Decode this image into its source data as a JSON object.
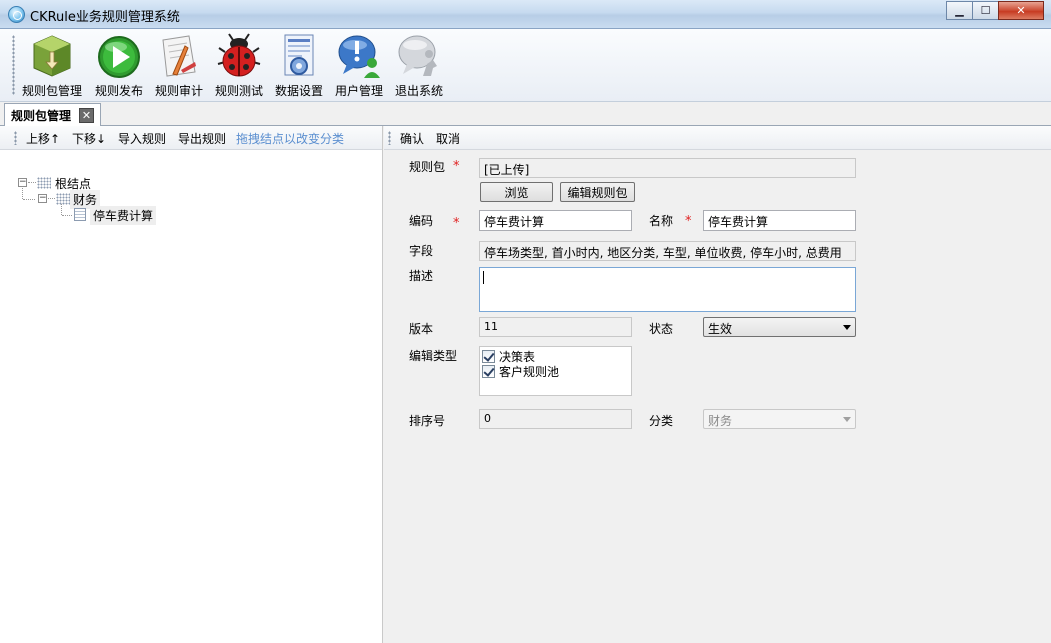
{
  "window": {
    "title": "CKRule业务规则管理系统",
    "minimize_glyph": "▁",
    "maximize_glyph": "☐",
    "close_glyph": "✕"
  },
  "toolbar": {
    "items": [
      {
        "label": "规则包管理",
        "icon": "package-icon"
      },
      {
        "label": "规则发布",
        "icon": "play-icon"
      },
      {
        "label": "规则审计",
        "icon": "audit-icon"
      },
      {
        "label": "规则测试",
        "icon": "bug-icon"
      },
      {
        "label": "数据设置",
        "icon": "data-settings-icon"
      },
      {
        "label": "用户管理",
        "icon": "user-icon"
      },
      {
        "label": "退出系统",
        "icon": "exit-icon"
      }
    ]
  },
  "tabs": [
    {
      "label": "规则包管理",
      "close_glyph": "✕"
    }
  ],
  "left_toolbar": {
    "move_up": "上移↑",
    "move_down": "下移↓",
    "import": "导入规则",
    "export": "导出规则",
    "hint": "拖拽结点以改变分类"
  },
  "tree": {
    "root": "根结点",
    "category": "财务",
    "leaf": "停车费计算",
    "expander_glyph": "−"
  },
  "right_toolbar": {
    "confirm": "确认",
    "cancel": "取消"
  },
  "form": {
    "required_mark": "*",
    "package_label": "规则包",
    "package_value": "[已上传]",
    "browse_button": "浏览",
    "edit_package_button": "编辑规则包",
    "code_label": "编码",
    "code_value": "停车费计算",
    "name_label": "名称",
    "name_value": "停车费计算",
    "fields_label": "字段",
    "fields_value": "停车场类型, 首小时内, 地区分类, 车型, 单位收费, 停车小时, 总费用",
    "description_label": "描述",
    "description_value": "",
    "version_label": "版本",
    "version_value": "11",
    "status_label": "状态",
    "status_value": "生效",
    "edit_type_label": "编辑类型",
    "edit_types": [
      {
        "label": "决策表",
        "checked": true
      },
      {
        "label": "客户规则池",
        "checked": true
      }
    ],
    "sort_label": "排序号",
    "sort_value": "0",
    "category_label": "分类",
    "category_value": "财务"
  }
}
